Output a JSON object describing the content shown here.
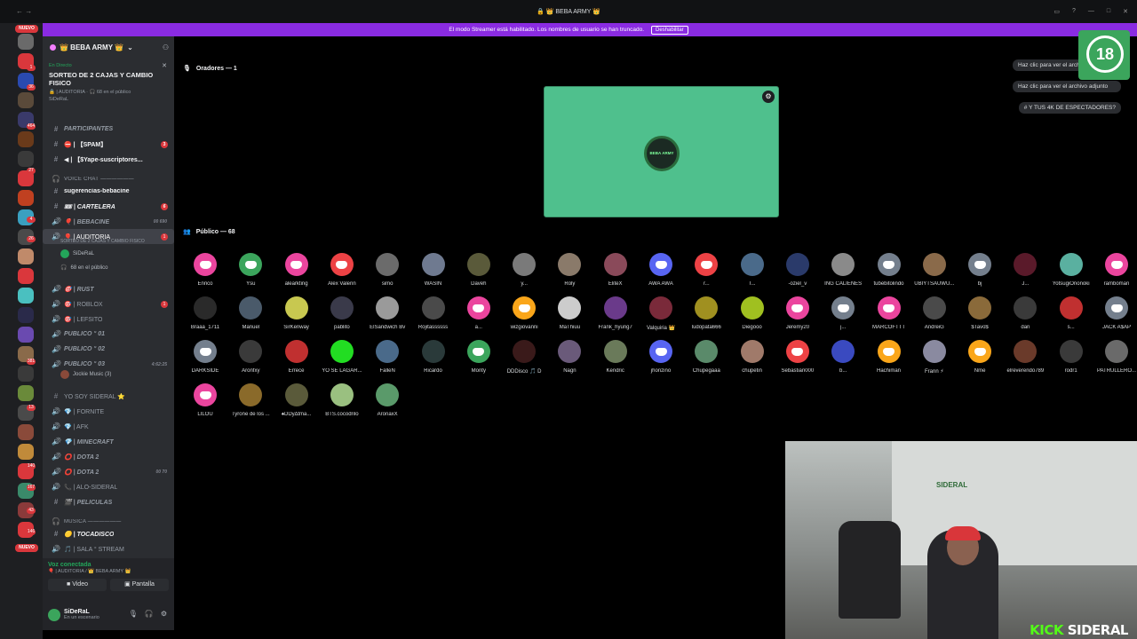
{
  "window": {
    "title": "🔒 👑 BEBA ARMY 👑"
  },
  "banner": {
    "text": "El modo Streamer está habilitado. Los nombres de usuario se han truncado.",
    "button": "Deshabilitar"
  },
  "rail": {
    "new_tag_top": "NUEVO",
    "new_tag_bottom": "NUEVO",
    "badges": [
      "1",
      "36",
      "464",
      "27",
      "4",
      "26",
      "381",
      "13",
      "140",
      "167",
      "43",
      "146"
    ]
  },
  "server": {
    "name": "👑 BEBA ARMY 👑"
  },
  "event": {
    "live": "En Directo",
    "title": "SORTEO DE 2 CAJAS Y CAMBIO FISICO",
    "sub": "🔒 | AUDITORIA · 🎧 68 en el público",
    "user": "SiDeRaL"
  },
  "channels": [
    {
      "icon": "#",
      "label": "PARTICIPANTES",
      "style": "it"
    },
    {
      "icon": "#",
      "label": "⛔ | 【SPAM】",
      "style": "bold",
      "badge": "3"
    },
    {
      "icon": "#",
      "label": "◀ | 【$Yape-suscriptores...",
      "style": "bold"
    },
    {
      "icon": "🎧",
      "label": "VOICE CHAT ——————",
      "style": "cat"
    },
    {
      "icon": "#",
      "label": "sugerencias-bebacine",
      "style": "bold"
    },
    {
      "icon": "#",
      "label": "🎟 | CARTELERA",
      "style": "bold it",
      "badge": "6"
    },
    {
      "icon": "🔊",
      "label": "🎈 | BEBACINE",
      "style": "it",
      "meta": "00 690"
    },
    {
      "icon": "🔊",
      "label": "🎈 | AUDITORIA",
      "style": "active",
      "badge": "1"
    },
    {
      "icon": "🔊",
      "label": "🎯 | RUST",
      "style": "it"
    },
    {
      "icon": "🔊",
      "label": "🎯 | ROBLOX",
      "style": "",
      "badge": "1"
    },
    {
      "icon": "🔊",
      "label": "🎯 | LEFSITO",
      "style": ""
    },
    {
      "icon": "🔊",
      "label": "PUBLICO ° 01",
      "style": "it"
    },
    {
      "icon": "🔊",
      "label": "PUBLICO ° 02",
      "style": "it"
    },
    {
      "icon": "🔊",
      "label": "PUBLICO ° 03",
      "style": "it",
      "meta": "4:62:25"
    },
    {
      "icon": "#",
      "label": "YO SOY SIDERAL ⭐",
      "style": ""
    },
    {
      "icon": "🔊",
      "label": "💎 | FORNITE",
      "style": ""
    },
    {
      "icon": "🔊",
      "label": "💎 | AFK",
      "style": ""
    },
    {
      "icon": "🔊",
      "label": "💎 | MINECRAFT",
      "style": "it"
    },
    {
      "icon": "🔊",
      "label": "⭕ | DOTA 2",
      "style": "it"
    },
    {
      "icon": "🔊",
      "label": "⭕ | DOTA 2",
      "style": "it",
      "meta": "00 70"
    },
    {
      "icon": "🔊",
      "label": "📞 | ALO-SIDERAL",
      "style": ""
    },
    {
      "icon": "#",
      "label": "🎬 | PELICULAS",
      "style": "it"
    },
    {
      "icon": "🎧",
      "label": "MUSICA ——————",
      "style": "cat"
    },
    {
      "icon": "#",
      "label": "🟡 | TOCADISCO",
      "style": "bold it"
    },
    {
      "icon": "🔊",
      "label": "🎵 | SALA ° STREAM",
      "style": ""
    }
  ],
  "auditoria_sub": {
    "title": "SORTEO DE 2 CAJAS Y CAMBIO FISICO",
    "user": "SiDeRaL",
    "public": "68 en el público"
  },
  "publico03_sub": {
    "user": "Jockie Music (3)"
  },
  "voice": {
    "status": "Voz conectada",
    "channel": "🎈 | AUDITORIA / 👑 BEBA ARMY 👑",
    "video": "Video",
    "screen": "Pantalla"
  },
  "user": {
    "name": "SiDeRaL",
    "status": "En un escenario"
  },
  "stage": {
    "speakers_label": "Oradores — 1",
    "public_label": "Público — 68",
    "logo_text": "BEBA ARMY"
  },
  "notifications": [
    "Haz clic para ver el archivo adjunto",
    "Haz clic para ver el archivo adjunto",
    "# Y TUS 4K DE ESPECTADORES?"
  ],
  "age_badge": "18",
  "audience": [
    {
      "name": "Enrico",
      "color": "#eb459e"
    },
    {
      "name": "Ysu",
      "color": "#3ba55c"
    },
    {
      "name": "alearkting",
      "color": "#eb459e"
    },
    {
      "name": "Álex Valerin",
      "color": "#ed4245"
    },
    {
      "name": "simo",
      "color": "#6b6b6b"
    },
    {
      "name": "WASIN",
      "color": "#6f7a90"
    },
    {
      "name": "Daveh",
      "color": "#5a5a3a"
    },
    {
      "name": "y...",
      "color": "#7a7a7a"
    },
    {
      "name": "Roly",
      "color": "#8a7a6a"
    },
    {
      "name": "EliteX",
      "color": "#8a4a5a"
    },
    {
      "name": "AWA AWA",
      "color": "#5865f2"
    },
    {
      "name": "r...",
      "color": "#ed4245"
    },
    {
      "name": "T...",
      "color": "#4a6a8a"
    },
    {
      "name": "-oziel_v",
      "color": "#2a3a6a"
    },
    {
      "name": "ING CALIENES",
      "color": "#8a8a8a"
    },
    {
      "name": "tubebitolindo",
      "color": "#747f8d"
    },
    {
      "name": "UBIYTSAUWU...",
      "color": "#8a6a4a"
    },
    {
      "name": "bj",
      "color": "#747f8d"
    },
    {
      "name": "J...",
      "color": "#5a1a2a"
    },
    {
      "name": "YotsugiOnonoki",
      "color": "#5ab0a0"
    },
    {
      "name": "ramboman",
      "color": "#eb459e"
    },
    {
      "name": "Braaa_1711",
      "color": "#2a2a2a"
    },
    {
      "name": "Manuel",
      "color": "#4a5a6a"
    },
    {
      "name": "SirKenway",
      "color": "#c8c850"
    },
    {
      "name": "pablito",
      "color": "#3a3a4a"
    },
    {
      "name": "ElSandwich Bv",
      "color": "#9a9a9a"
    },
    {
      "name": "Rojitassssss",
      "color": "#4a4a4a"
    },
    {
      "name": "a...",
      "color": "#eb459e"
    },
    {
      "name": "wizgiovanni",
      "color": "#faa61a"
    },
    {
      "name": "MaThiuu",
      "color": "#cccccc"
    },
    {
      "name": "Frank_hyung7",
      "color": "#6a3a8a"
    },
    {
      "name": "Valquiria 👑",
      "color": "#7a2a3a"
    },
    {
      "name": "ludopata666",
      "color": "#a09020"
    },
    {
      "name": "Diegooo",
      "color": "#a0c020"
    },
    {
      "name": "Jeremy20",
      "color": "#eb459e"
    },
    {
      "name": "j...",
      "color": "#747f8d"
    },
    {
      "name": "MARCOFTTT",
      "color": "#eb459e"
    },
    {
      "name": "AndreiG",
      "color": "#4a4a4a"
    },
    {
      "name": "$Tavo$",
      "color": "#8a6a3a"
    },
    {
      "name": "dan",
      "color": "#3a3a3a"
    },
    {
      "name": "s...",
      "color": "#c03030"
    },
    {
      "name": "JACK A$AP",
      "color": "#747f8d"
    },
    {
      "name": "DARKSIDE",
      "color": "#747f8d"
    },
    {
      "name": "Aronfxy",
      "color": "#3a3a3a"
    },
    {
      "name": "Errece",
      "color": "#c03030"
    },
    {
      "name": "YO SE LAGAR...",
      "color": "#22dd22"
    },
    {
      "name": "FalleN",
      "color": "#4a6a8a"
    },
    {
      "name": "Ricardo",
      "color": "#2a3a3a"
    },
    {
      "name": "Monty",
      "color": "#3ba55c"
    },
    {
      "name": "DDDisco 🎵 D",
      "color": "#3a1a1a"
    },
    {
      "name": "Nagn",
      "color": "#6a5a7a"
    },
    {
      "name": "Kendric",
      "color": "#6a7a5a"
    },
    {
      "name": "jhonziño",
      "color": "#5865f2"
    },
    {
      "name": "Chupegaaa",
      "color": "#5a8a6a"
    },
    {
      "name": "chupetin",
      "color": "#a07a6a"
    },
    {
      "name": "Sebastian000",
      "color": "#ed4245"
    },
    {
      "name": "b...",
      "color": "#3a4ac0"
    },
    {
      "name": "Hachiman",
      "color": "#faa61a"
    },
    {
      "name": "Frann ⚡",
      "color": "#8a8aa0"
    },
    {
      "name": "Nme",
      "color": "#faa61a"
    },
    {
      "name": "elreverendo789",
      "color": "#6a3a2a"
    },
    {
      "name": "rodr1",
      "color": "#3a3a3a"
    },
    {
      "name": "PATRULLERO...",
      "color": "#6a6a6a"
    },
    {
      "name": "LILOU",
      "color": "#eb459e"
    },
    {
      "name": "Tyrone de los ...",
      "color": "#8a6a2a"
    },
    {
      "name": "♠DDy∆tma...",
      "color": "#5a5a3a"
    },
    {
      "name": "BTS.cocodrilo",
      "color": "#9ac080"
    },
    {
      "name": "AronaxX",
      "color": "#5a9a6a"
    }
  ],
  "cam_brand": {
    "kick": "KICK",
    "name": "SIDERAL"
  }
}
